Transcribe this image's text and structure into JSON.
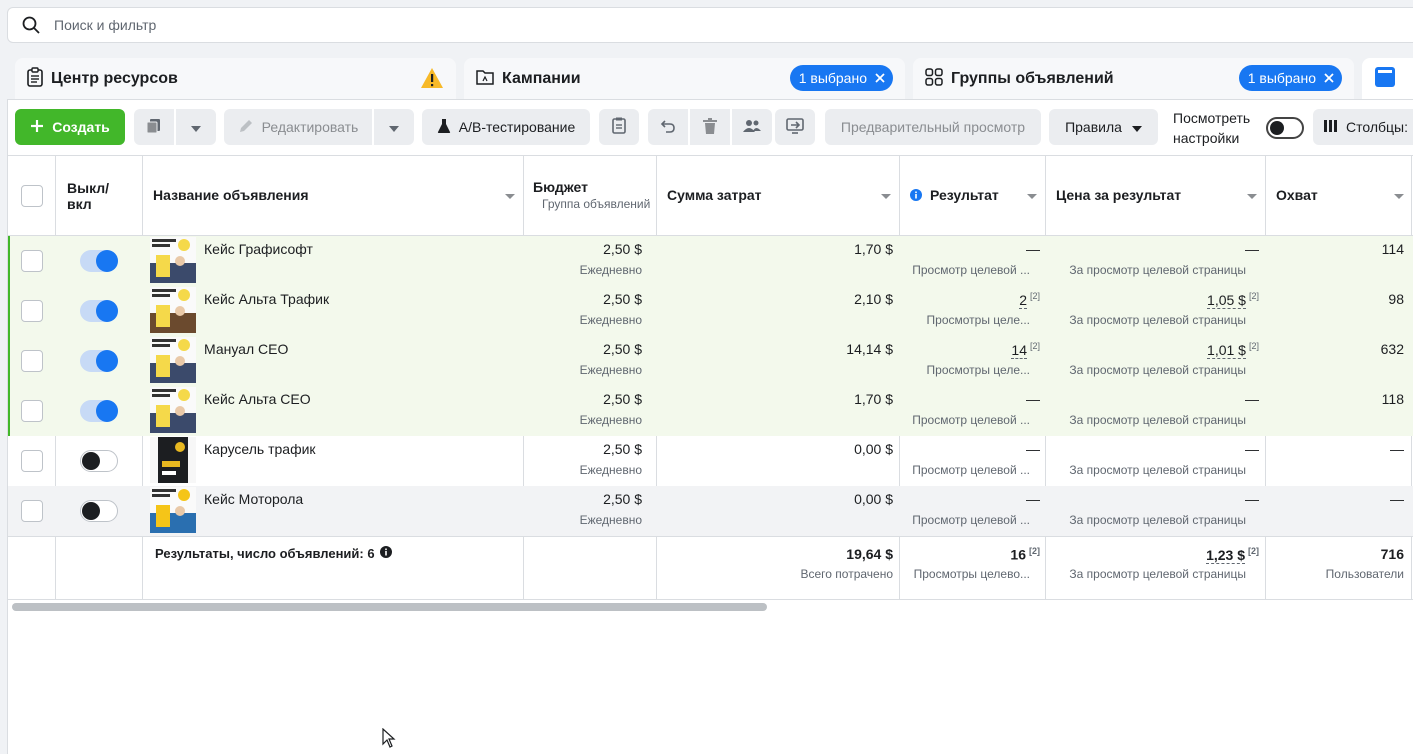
{
  "search": {
    "placeholder": "Поиск и фильтр"
  },
  "tabs": [
    {
      "label": "Центр ресурсов",
      "icon": "clipboard-icon",
      "badge": ""
    },
    {
      "label": "Кампании",
      "icon": "folder-icon",
      "badge": "1 выбрано"
    },
    {
      "label": "Группы объявлений",
      "icon": "grid-icon",
      "badge": "1 выбрано"
    }
  ],
  "toolbar": {
    "create": "Создать",
    "edit": "Редактировать",
    "ab_test": "A/B-тестирование",
    "preview": "Предварительный просмотр",
    "rules": "Правила",
    "view_settings_line1": "Посмотреть",
    "view_settings_line2": "настройки",
    "columns": "Столбцы:"
  },
  "columns": {
    "onoff_line1": "Выкл/",
    "onoff_line2": "вкл",
    "name": "Название объявления",
    "budget": "Бюджет",
    "budget_sub": "Группа объявлений",
    "spend": "Сумма затрат",
    "result": "Результат",
    "cpr": "Цена за результат",
    "reach": "Охват"
  },
  "rows": [
    {
      "name": "Кейс Графисофт",
      "on": true,
      "budget": "2,50 $",
      "budget_sub": "Ежедневно",
      "spend": "1,70 $",
      "result": "—",
      "result_sub": "Просмотр целевой ...",
      "cpr": "—",
      "cpr_sub": "За просмотр целевой страницы",
      "reach": "114"
    },
    {
      "name": "Кейс Альта Трафик",
      "on": true,
      "budget": "2,50 $",
      "budget_sub": "Ежедневно",
      "spend": "2,10 $",
      "result": "2",
      "result_sub": "Просмотры целе...",
      "cpr": "1,05 $",
      "cpr_sub": "За просмотр целевой страницы",
      "reach": "98"
    },
    {
      "name": "Мануал CEO",
      "on": true,
      "budget": "2,50 $",
      "budget_sub": "Ежедневно",
      "spend": "14,14 $",
      "result": "14",
      "result_sub": "Просмотры целе...",
      "cpr": "1,01 $",
      "cpr_sub": "За просмотр целевой страницы",
      "reach": "632"
    },
    {
      "name": "Кейс Альта CEO",
      "on": true,
      "budget": "2,50 $",
      "budget_sub": "Ежедневно",
      "spend": "1,70 $",
      "result": "—",
      "result_sub": "Просмотр целевой ...",
      "cpr": "—",
      "cpr_sub": "За просмотр целевой страницы",
      "reach": "118"
    },
    {
      "name": "Карусель трафик",
      "on": false,
      "budget": "2,50 $",
      "budget_sub": "Ежедневно",
      "spend": "0,00 $",
      "result": "—",
      "result_sub": "Просмотр целевой ...",
      "cpr": "—",
      "cpr_sub": "За просмотр целевой страницы",
      "reach": "—"
    },
    {
      "name": "Кейс Моторола",
      "on": false,
      "budget": "2,50 $",
      "budget_sub": "Ежедневно",
      "spend": "0,00 $",
      "result": "—",
      "result_sub": "Просмотр целевой ...",
      "cpr": "—",
      "cpr_sub": "За просмотр целевой страницы",
      "reach": "—"
    }
  ],
  "footer": {
    "label": "Результаты, число объявлений: 6",
    "spend": "19,64 $",
    "spend_sub": "Всего потрачено",
    "result": "16",
    "result_sub": "Просмотры целево...",
    "cpr": "1,23 $",
    "cpr_sub": "За просмотр целевой страницы",
    "reach": "716",
    "reach_sub": "Пользователи"
  },
  "footnote_mark": "[2]",
  "colors": {
    "accent": "#1877f2",
    "create": "#42b72a",
    "active_row": "#f3f9ec"
  }
}
